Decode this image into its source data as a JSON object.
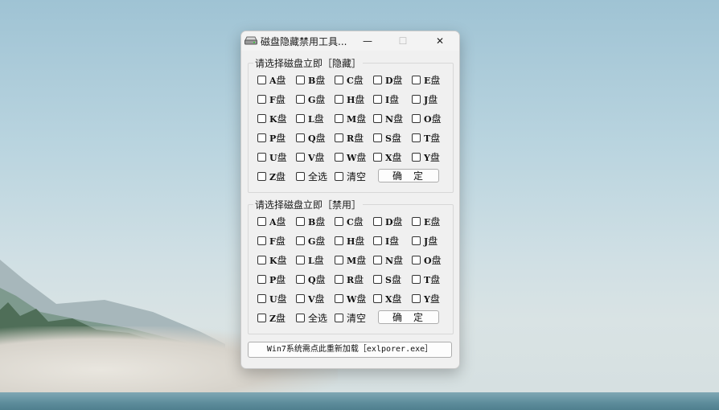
{
  "window": {
    "title": "磁盘隐藏禁用工具...",
    "minimize_glyph": "—",
    "maximize_glyph": "☐",
    "close_glyph": "✕",
    "icon": "drive-icon"
  },
  "groups": [
    {
      "legend": "请选择磁盘立即［隐藏］",
      "drives": [
        "A",
        "B",
        "C",
        "D",
        "E",
        "F",
        "G",
        "H",
        "I",
        "J",
        "K",
        "L",
        "M",
        "N",
        "O",
        "P",
        "Q",
        "R",
        "S",
        "T",
        "U",
        "V",
        "W",
        "X",
        "Y",
        "Z"
      ],
      "drive_suffix": "盘",
      "select_all": "全选",
      "clear": "清空",
      "confirm": "确定"
    },
    {
      "legend": "请选择磁盘立即［禁用］",
      "drives": [
        "A",
        "B",
        "C",
        "D",
        "E",
        "F",
        "G",
        "H",
        "I",
        "J",
        "K",
        "L",
        "M",
        "N",
        "O",
        "P",
        "Q",
        "R",
        "S",
        "T",
        "U",
        "V",
        "W",
        "X",
        "Y",
        "Z"
      ],
      "drive_suffix": "盘",
      "select_all": "全选",
      "clear": "清空",
      "confirm": "确定"
    }
  ],
  "restart_button": "Win7系统需点此重新加载［exlporer.exe］"
}
